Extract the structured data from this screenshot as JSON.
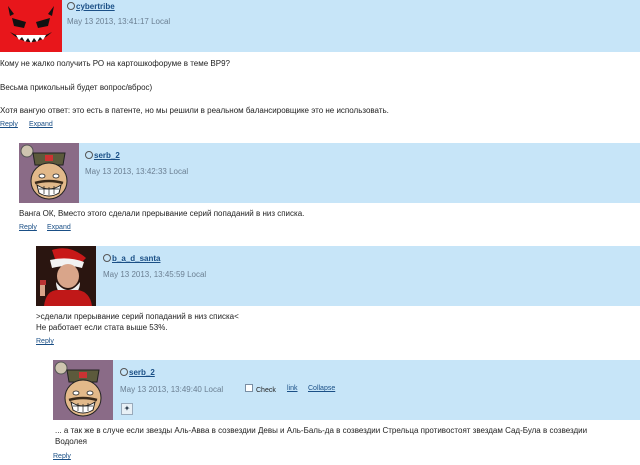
{
  "comments": [
    {
      "username": "cybertribe",
      "date": "May 13 2013, 13:41:17 Local",
      "lines": [
        "Кому не жалко получить РО на картошкофоруме в теме ВР9?",
        "Весьма прикольный будет вопрос/вброс)",
        "Хотя вангую ответ: это есть в патенте, но мы решили в реальном балансировщике это не использовать."
      ],
      "reply": "Reply",
      "expand": "Expand"
    },
    {
      "username": "serb_2",
      "date": "May 13 2013, 13:42:33 Local",
      "lines": [
        "Ванга ОК, Вместо этого сделали прерывание серий попаданий в низ списка."
      ],
      "reply": "Reply",
      "expand": "Expand"
    },
    {
      "username": "b_a_d_santa",
      "date": "May 13 2013, 13:45:59 Local",
      "lines": [
        ">сделали прерывание серий попаданий в низ списка<",
        "Не работает если стата выше 53%."
      ],
      "reply": "Reply"
    },
    {
      "username": "serb_2",
      "date": "May 13 2013, 13:49:40 Local",
      "check": "Check",
      "link": "link",
      "collapse": "Collapse",
      "lines": [
        "... а так же в случе если звезды Аль-Авва в созвездии Девы и Аль-Баль-да в созвездии Стрельца противостоят звездам Сад-Була в созвездии",
        "Водолея"
      ],
      "reply": "Reply"
    }
  ]
}
